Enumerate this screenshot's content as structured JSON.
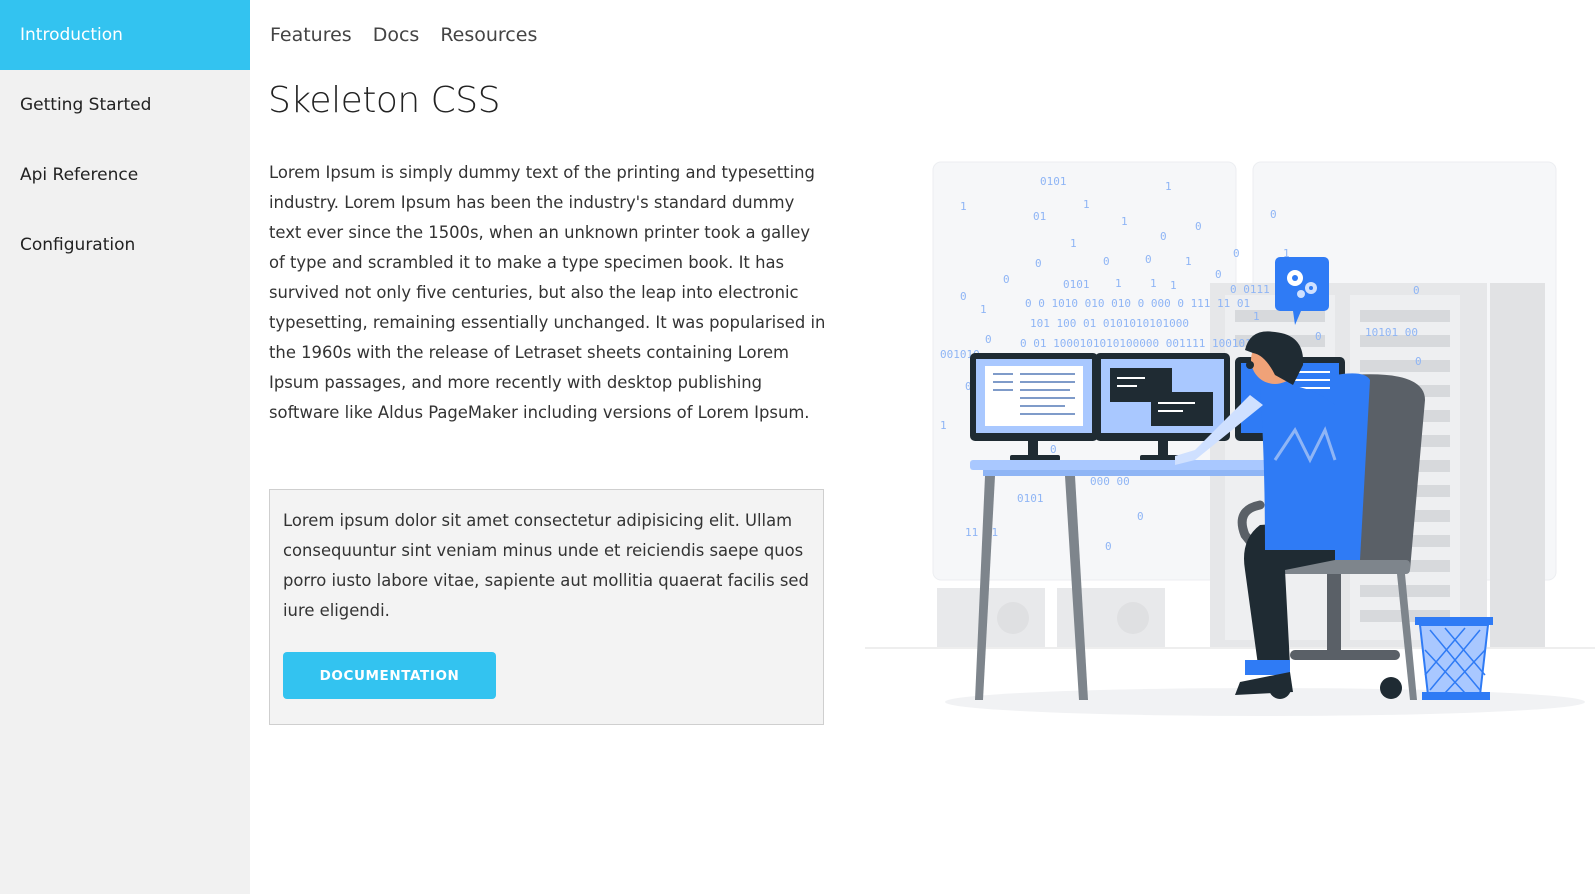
{
  "sidebar": {
    "items": [
      {
        "label": "Introduction",
        "active": true
      },
      {
        "label": "Getting Started",
        "active": false
      },
      {
        "label": "Api Reference",
        "active": false
      },
      {
        "label": "Configuration",
        "active": false
      }
    ]
  },
  "topnav": {
    "links": [
      "Features",
      "Docs",
      "Resources"
    ]
  },
  "main": {
    "title": "Skeleton CSS",
    "intro": "Lorem Ipsum is simply dummy text of the printing and typesetting industry. Lorem Ipsum has been the industry's standard dummy text ever since the 1500s, when an unknown printer took a galley of type and scrambled it to make a type specimen book. It has survived not only five centuries, but also the leap into electronic typesetting, remaining essentially unchanged. It was popularised in the 1960s with the release of Letraset sheets containing Lorem Ipsum passages, and more recently with desktop publishing software like Aldus PageMaker including versions of Lorem Ipsum.",
    "callout_text": "Lorem ipsum dolor sit amet consectetur adipisicing elit. Ullam consequuntur sint veniam minus unde et reiciendis saepe quos porro iusto labore vitae, sapiente aut mollitia quaerat facilis sed iure eligendi.",
    "button_label": "DOCUMENTATION"
  },
  "colors": {
    "accent": "#33c3f0",
    "sidebar_bg": "#f1f1f1",
    "callout_bg": "#f3f3f3",
    "illustration_blue": "#2f7bf5"
  }
}
